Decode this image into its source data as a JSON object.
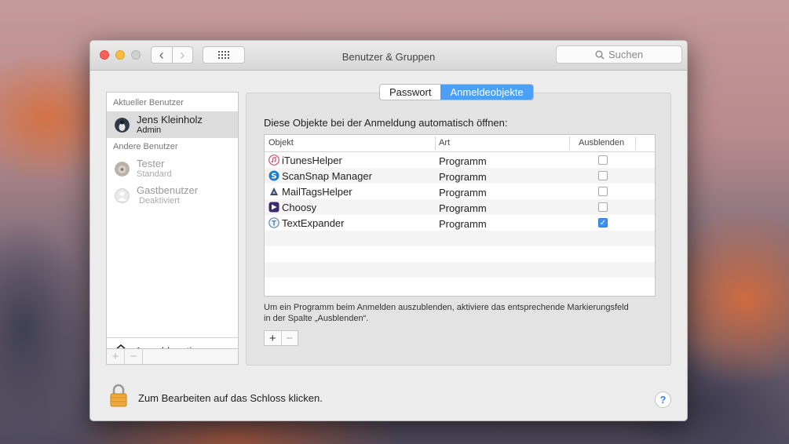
{
  "window": {
    "title": "Benutzer & Gruppen",
    "search_placeholder": "Suchen"
  },
  "sidebar": {
    "current_header": "Aktueller Benutzer",
    "other_header": "Andere Benutzer",
    "users": [
      {
        "name": "Jens Kleinholz",
        "role": "Admin"
      },
      {
        "name": "Tester",
        "role": "Standard"
      },
      {
        "name": "Gastbenutzer",
        "role": "Deaktiviert"
      }
    ],
    "login_options": "Anmeldeoptionen",
    "add": "+",
    "remove": "−"
  },
  "tabs": [
    {
      "label": "Passwort",
      "active": false
    },
    {
      "label": "Anmeldeobjekte",
      "active": true
    }
  ],
  "main": {
    "heading": "Diese Objekte bei der Anmeldung automatisch öffnen:",
    "columns": [
      "Objekt",
      "Art",
      "Ausblenden"
    ],
    "items": [
      {
        "name": "iTunesHelper",
        "type": "Programm",
        "hidden": false,
        "icon": "itunes-icon"
      },
      {
        "name": "ScanSnap Manager",
        "type": "Programm",
        "hidden": false,
        "icon": "scansnap-icon"
      },
      {
        "name": "MailTagsHelper",
        "type": "Programm",
        "hidden": false,
        "icon": "mailtags-icon"
      },
      {
        "name": "Choosy",
        "type": "Programm",
        "hidden": false,
        "icon": "choosy-icon"
      },
      {
        "name": "TextExpander",
        "type": "Programm",
        "hidden": true,
        "icon": "textexpander-icon"
      }
    ],
    "hint": "Um ein Programm beim Anmelden auszublenden, aktiviere das entsprechende Markierungsfeld in der Spalte „Ausblenden“.",
    "add": "+",
    "remove": "−"
  },
  "footer": {
    "lock_text": "Zum Bearbeiten auf das Schloss klicken.",
    "help": "?"
  },
  "colors": {
    "accent": "#4b9ff5",
    "close": "#fc605c",
    "minimize": "#fdbc40"
  }
}
